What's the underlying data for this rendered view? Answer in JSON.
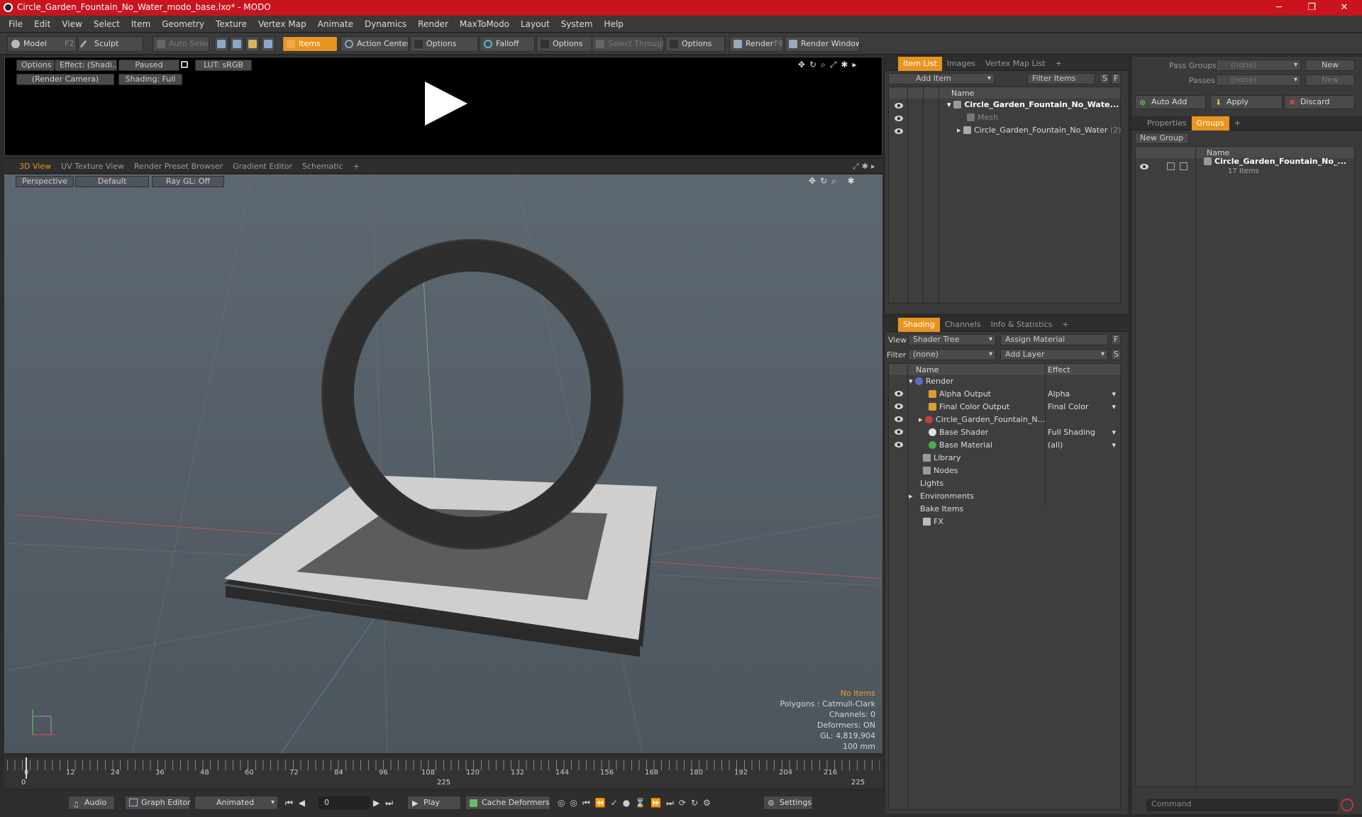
{
  "window": {
    "title": "Circle_Garden_Fountain_No_Water_modo_base.lxo* - MODO",
    "min": "─",
    "max": "❐",
    "close": "✕"
  },
  "menu": [
    "File",
    "Edit",
    "View",
    "Select",
    "Item",
    "Geometry",
    "Texture",
    "Vertex Map",
    "Animate",
    "Dynamics",
    "Render",
    "MaxToModo",
    "Layout",
    "System",
    "Help"
  ],
  "toolbar": {
    "model": "Model",
    "model_key": "F2",
    "sculpt": "Sculpt",
    "auto_select": "Auto Select",
    "items": "Items",
    "action_center": "Action Center",
    "options1": "Options",
    "falloff": "Falloff",
    "options2": "Options",
    "select_through": "Select Through",
    "options3": "Options",
    "render": "Render",
    "render_key": "F9",
    "render_window": "Render Window"
  },
  "preview": {
    "options": "Options",
    "effect": "Effect: (Shadi...",
    "paused": "Paused",
    "lut": "LUT: sRGB",
    "camera": "(Render Camera)",
    "shading": "Shading: Full"
  },
  "viewport_tabs": [
    "3D View",
    "UV Texture View",
    "Render Preset Browser",
    "Gradient Editor",
    "Schematic",
    "+"
  ],
  "viewport": {
    "perspective": "Perspective",
    "default": "Default",
    "raygl": "Ray GL: Off",
    "info": {
      "items": "No Items",
      "polygons": "Polygons : Catmull-Clark",
      "channels": "Channels: 0",
      "deformers": "Deformers: ON",
      "gl": "GL: 4,819,904",
      "scale": "100 mm"
    }
  },
  "timeline": {
    "ticks": [
      "0",
      "12",
      "24",
      "36",
      "48",
      "60",
      "72",
      "84",
      "96",
      "108",
      "120",
      "132",
      "144",
      "156",
      "168",
      "180",
      "192",
      "204",
      "216"
    ],
    "start": "0",
    "mid": "225",
    "end": "225"
  },
  "bottombar": {
    "audio": "Audio",
    "graph_editor": "Graph Editor",
    "animated": "Animated",
    "frame": "0",
    "play": "Play",
    "cache": "Cache Deformers",
    "settings": "Settings"
  },
  "item_list": {
    "tabs": [
      "Item List",
      "Images",
      "Vertex Map List",
      "+"
    ],
    "add_item": "Add Item",
    "filter": "Filter Items",
    "s": "S",
    "f": "F",
    "col_name": "Name",
    "rows": [
      {
        "label": "Circle_Garden_Fountain_No_Wate..."
      },
      {
        "label": "Mesh"
      },
      {
        "label": "Circle_Garden_Fountain_No_Water",
        "count": "(2)"
      }
    ]
  },
  "shading": {
    "tabs": [
      "Shading",
      "Channels",
      "Info & Statistics",
      "+"
    ],
    "view_label": "View",
    "view_value": "Shader Tree",
    "assign": "Assign Material",
    "f": "F",
    "filter_label": "Filter",
    "filter_value": "(none)",
    "add_layer": "Add Layer",
    "s": "S",
    "col_name": "Name",
    "col_effect": "Effect",
    "rows": [
      {
        "name": "Render",
        "effect": ""
      },
      {
        "name": "Alpha Output",
        "effect": "Alpha"
      },
      {
        "name": "Final Color Output",
        "effect": "Final Color"
      },
      {
        "name": "Circle_Garden_Fountain_N...",
        "effect": ""
      },
      {
        "name": "Base Shader",
        "effect": "Full Shading"
      },
      {
        "name": "Base Material",
        "effect": "(all)"
      },
      {
        "name": "Library",
        "effect": ""
      },
      {
        "name": "Nodes",
        "effect": ""
      },
      {
        "name": "Lights",
        "effect": ""
      },
      {
        "name": "Environments",
        "effect": ""
      },
      {
        "name": "Bake Items",
        "effect": ""
      },
      {
        "name": "FX",
        "effect": ""
      }
    ]
  },
  "groups": {
    "pass_groups": "Pass Groups",
    "pass_groups_value": "(none)",
    "new": "New",
    "passes": "Passes",
    "passes_value": "(none)",
    "new2": "New",
    "auto_add": "Auto Add",
    "apply": "Apply",
    "discard": "Discard",
    "tabs": [
      "Properties",
      "Groups",
      "+"
    ],
    "new_group": "New Group",
    "col_name": "Name",
    "group_name": "Circle_Garden_Fountain_No_...",
    "group_count": "17 Items",
    "command_placeholder": "Command"
  }
}
